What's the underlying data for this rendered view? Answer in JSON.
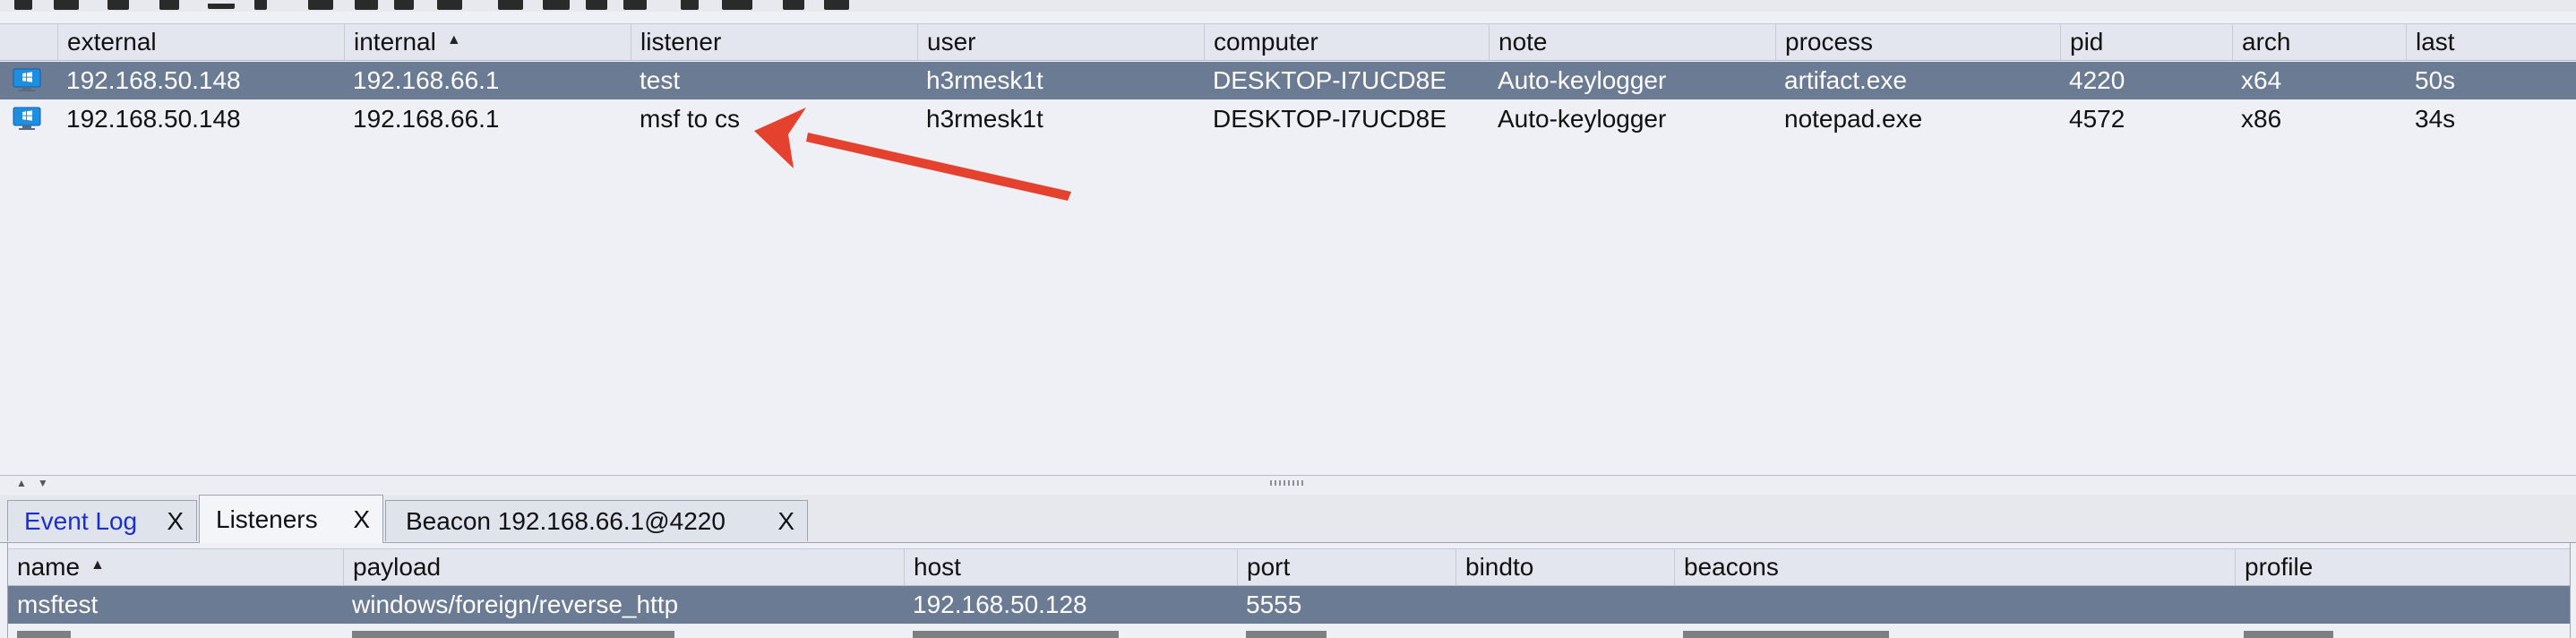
{
  "sessions_table": {
    "columns": [
      {
        "key": "icon",
        "label": ""
      },
      {
        "key": "external",
        "label": "external"
      },
      {
        "key": "internal",
        "label": "internal",
        "sorted": "asc"
      },
      {
        "key": "listener",
        "label": "listener"
      },
      {
        "key": "user",
        "label": "user"
      },
      {
        "key": "computer",
        "label": "computer"
      },
      {
        "key": "note",
        "label": "note"
      },
      {
        "key": "process",
        "label": "process"
      },
      {
        "key": "pid",
        "label": "pid"
      },
      {
        "key": "arch",
        "label": "arch"
      },
      {
        "key": "last",
        "label": "last"
      }
    ],
    "rows": [
      {
        "os_icon": "windows-icon",
        "external": "192.168.50.148",
        "internal": "192.168.66.1",
        "listener": "test",
        "user": "h3rmesk1t",
        "computer": "DESKTOP-I7UCD8E",
        "note": "Auto-keylogger",
        "process": "artifact.exe",
        "pid": "4220",
        "arch": "x64",
        "last": "50s",
        "selected": true
      },
      {
        "os_icon": "windows-icon",
        "external": "192.168.50.148",
        "internal": "192.168.66.1",
        "listener": "msf to cs",
        "user": "h3rmesk1t",
        "computer": "DESKTOP-I7UCD8E",
        "note": "Auto-keylogger",
        "process": "notepad.exe",
        "pid": "4572",
        "arch": "x86",
        "last": "34s",
        "selected": false
      }
    ]
  },
  "annotation": {
    "type": "arrow",
    "color": "#e4412e",
    "points_to": "msf to cs"
  },
  "tabs": [
    {
      "label": "Event Log",
      "close": "X",
      "active": false,
      "link": true
    },
    {
      "label": "Listeners",
      "close": "X",
      "active": true,
      "link": false
    },
    {
      "label": "Beacon 192.168.66.1@4220",
      "close": "X",
      "active": false,
      "link": false
    }
  ],
  "listeners_table": {
    "columns": [
      {
        "key": "name",
        "label": "name",
        "sorted": "asc"
      },
      {
        "key": "payload",
        "label": "payload"
      },
      {
        "key": "host",
        "label": "host"
      },
      {
        "key": "port",
        "label": "port"
      },
      {
        "key": "bindto",
        "label": "bindto"
      },
      {
        "key": "beacons",
        "label": "beacons"
      },
      {
        "key": "profile",
        "label": "profile"
      }
    ],
    "rows": [
      {
        "name": "msftest",
        "payload": "windows/foreign/reverse_http",
        "host": "192.168.50.128",
        "port": "5555",
        "bindto": "",
        "beacons": "",
        "profile": "",
        "selected": true
      }
    ]
  },
  "colors": {
    "selection": "#6b7b93",
    "accent_link": "#1b2fd1",
    "arrow": "#e4412e",
    "windows_blue": "#1e8fe0"
  }
}
